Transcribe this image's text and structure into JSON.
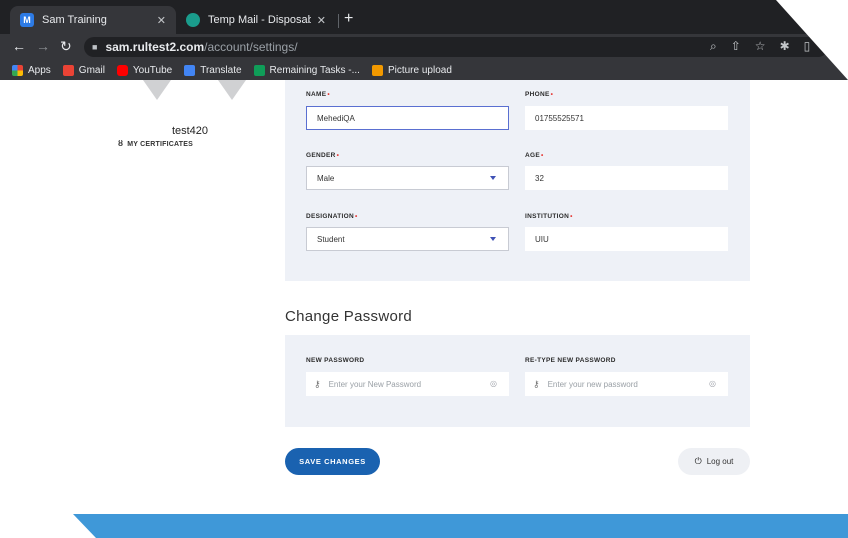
{
  "browser": {
    "tabs": [
      {
        "title": "Sam Training",
        "icon": "sam-training-favicon"
      },
      {
        "title": "Temp Mail - Disposable Tempo",
        "icon": "temp-mail-favicon"
      }
    ],
    "url_host": "sam.rultest2.com",
    "url_path": "/account/settings/",
    "bookmarks": [
      {
        "label": "Apps"
      },
      {
        "label": "Gmail"
      },
      {
        "label": "YouTube"
      },
      {
        "label": "Translate"
      },
      {
        "label": "Remaining Tasks -..."
      },
      {
        "label": "Picture upload"
      }
    ]
  },
  "profile": {
    "username": "test420",
    "certificates_label": "MY CERTIFICATES"
  },
  "form": {
    "name": {
      "label": "NAME",
      "value": "MehediQA"
    },
    "phone": {
      "label": "PHONE",
      "value": "01755525571"
    },
    "gender": {
      "label": "GENDER",
      "value": "Male"
    },
    "age": {
      "label": "AGE",
      "value": "32"
    },
    "designation": {
      "label": "DESIGNATION",
      "value": "Student"
    },
    "institution": {
      "label": "INSTITUTION",
      "value": "UIU"
    }
  },
  "password": {
    "title": "Change Password",
    "new_label": "NEW PASSWORD",
    "new_placeholder": "Enter your New Password",
    "retype_label": "RE-TYPE NEW PASSWORD",
    "retype_placeholder": "Enter your new password"
  },
  "actions": {
    "save": "SAVE CHANGES",
    "logout": "Log out"
  },
  "colors": {
    "accent": "#1a62b0",
    "required": "#e53935",
    "card": "#eef1f7",
    "footer": "#3f98d8"
  }
}
